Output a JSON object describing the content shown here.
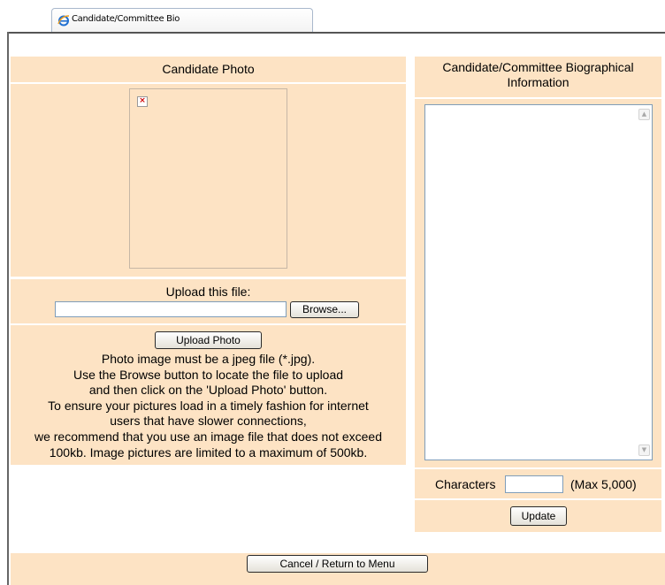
{
  "tab": {
    "title": "Candidate/Committee Bio",
    "icon": "ie-icon"
  },
  "photo_section": {
    "header": "Candidate Photo",
    "upload_label": "Upload this file:",
    "file_value": "",
    "browse_label": "Browse...",
    "upload_button": "Upload Photo",
    "instructions": [
      "Photo image must be a jpeg file (*.jpg).",
      "Use the Browse button to locate the file to upload",
      "and then click on the 'Upload Photo' button.",
      "To ensure your pictures load in a timely fashion for internet",
      "users that have slower connections,",
      "we recommend that you use an image file that does not exceed",
      "100kb. Image pictures are limited to a maximum of 500kb."
    ]
  },
  "bio_section": {
    "header": "Candidate/Committee Biographical Information",
    "bio_text": "",
    "characters_label": "Characters",
    "characters_value": "",
    "max_label": "(Max 5,000)",
    "update_button": "Update"
  },
  "footer": {
    "cancel_button": "Cancel / Return to Menu"
  }
}
